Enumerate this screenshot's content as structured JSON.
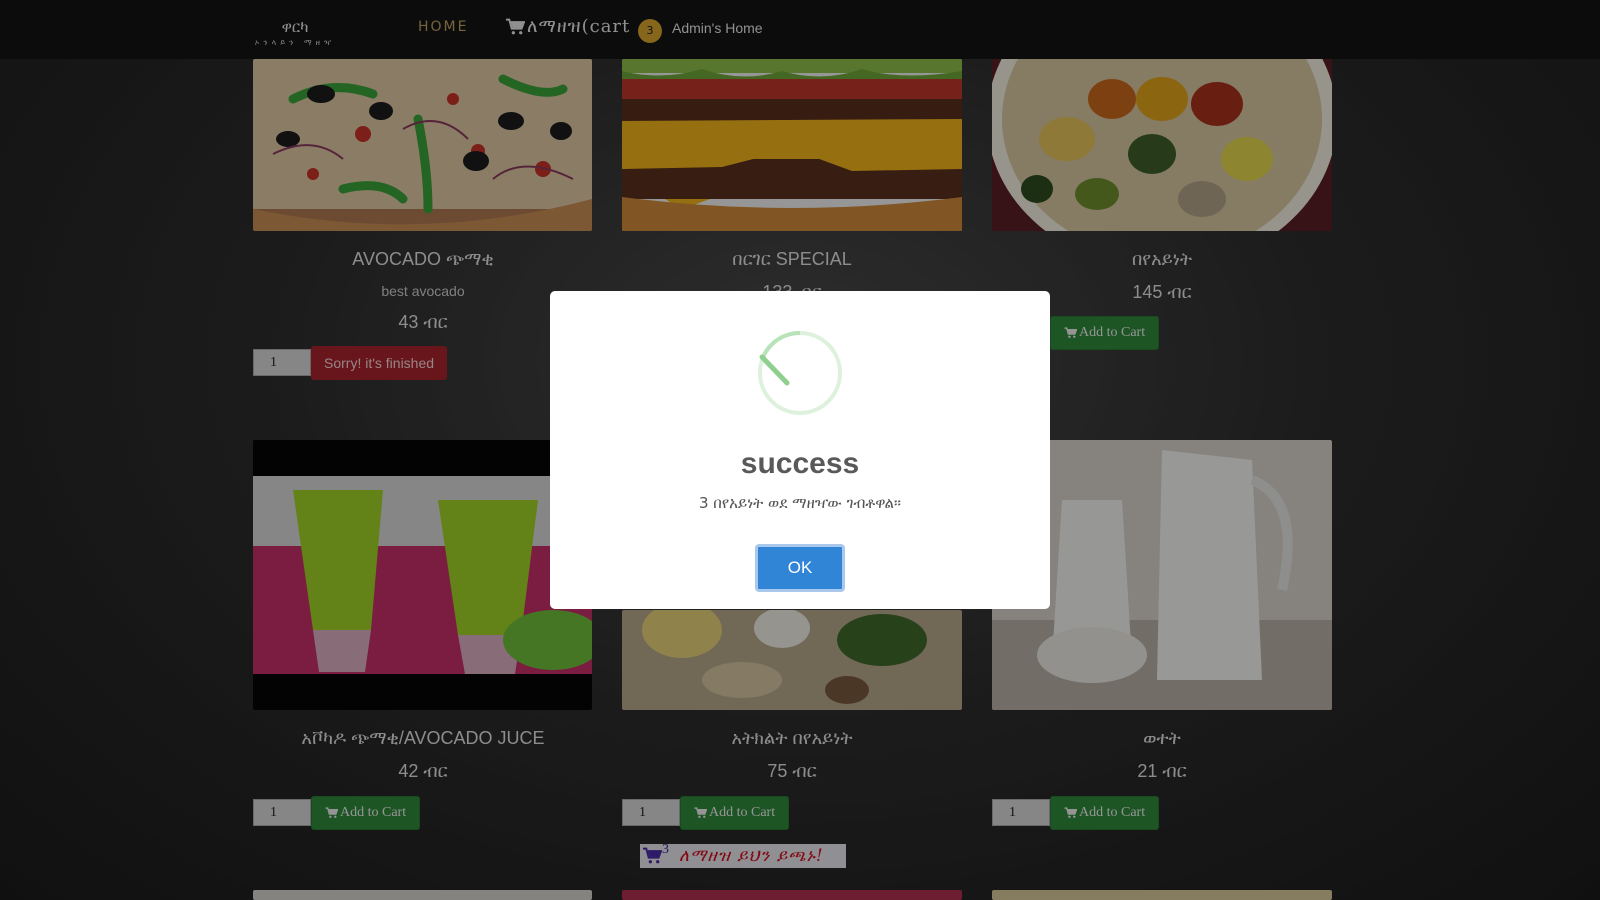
{
  "navbar": {
    "brand_title": "ዋርካ",
    "brand_subtitle": "ኦንላይን ማዘዣ",
    "home_label": "HOME",
    "cart_label": "ለማዘዝ(cart",
    "cart_count": "3",
    "admin_label": "Admin's Home"
  },
  "products": [
    {
      "name": "AVOCADO ጭማቂ",
      "description": "best avocado",
      "price": "43 ብር",
      "qty": "1",
      "button": "Sorry! it's finished",
      "status": "finished"
    },
    {
      "name": "በርገር SPECIAL",
      "price": "133 ብር"
    },
    {
      "name": "በየአይነት",
      "price": "145 ብር",
      "button": "Add to Cart"
    },
    {
      "name": "አቮካዶ ጭማቂ/AVOCADO JUCE",
      "price": "42 ብር",
      "qty": "1",
      "button": "Add to Cart"
    },
    {
      "name": "አትክልት በየአይነት",
      "price": "75 ብር",
      "qty": "1",
      "button": "Add to Cart"
    },
    {
      "name": "ወተት",
      "price": "21 ብር",
      "qty": "1",
      "button": "Add to Cart"
    }
  ],
  "floating_cart": {
    "count": "3",
    "text": "ለማዘዝ ይህን ይጫኑ!"
  },
  "modal": {
    "title": "success",
    "message": "3 በየአይነት ወደ ማዘዣው ገብቶዋል።",
    "ok_label": "OK"
  },
  "colors": {
    "add_button": "#2f8a3c",
    "finished_button": "#a8232e",
    "ok_button": "#3085d6",
    "badge": "#d9a52a",
    "home_link": "#c0a063"
  }
}
